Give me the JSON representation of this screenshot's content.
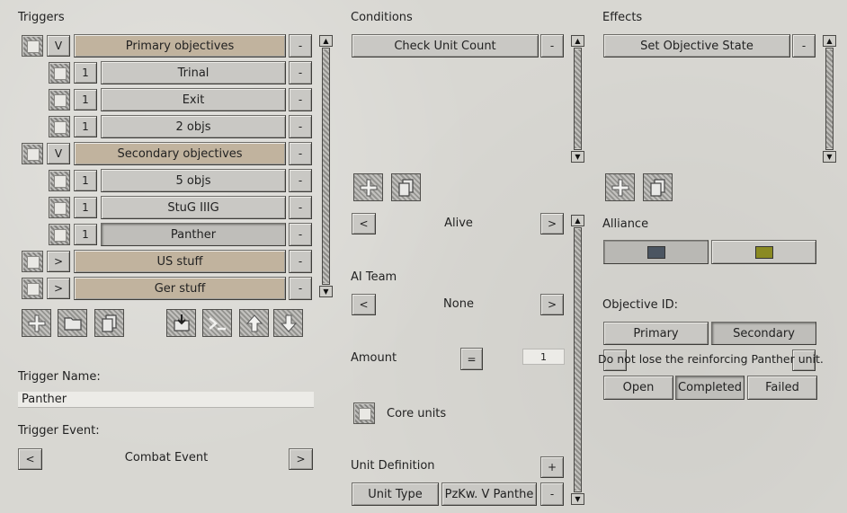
{
  "triggers": {
    "header": "Triggers",
    "rows": [
      {
        "toggle": "V",
        "name": "Primary objectives",
        "kind": "group"
      },
      {
        "toggle": "1",
        "name": "Trinal",
        "kind": "child"
      },
      {
        "toggle": "1",
        "name": "Exit",
        "kind": "child"
      },
      {
        "toggle": "1",
        "name": "2 objs",
        "kind": "child"
      },
      {
        "toggle": "V",
        "name": "Secondary objectives",
        "kind": "group"
      },
      {
        "toggle": "1",
        "name": "5 objs",
        "kind": "child"
      },
      {
        "toggle": "1",
        "name": "StuG IIIG",
        "kind": "child"
      },
      {
        "toggle": "1",
        "name": "Panther",
        "kind": "child-selected"
      },
      {
        "toggle": ">",
        "name": "US stuff",
        "kind": "group"
      },
      {
        "toggle": ">",
        "name": "Ger stuff",
        "kind": "group"
      }
    ],
    "remove_label": "-",
    "trigger_name_label": "Trigger Name:",
    "trigger_name_value": "Panther",
    "trigger_event_label": "Trigger Event:",
    "trigger_event_value": "Combat Event",
    "prev_label": "<",
    "next_label": ">"
  },
  "conditions": {
    "header": "Conditions",
    "item": "Check Unit Count",
    "remove_label": "-",
    "state_prev": "<",
    "state_value": "Alive",
    "state_next": ">",
    "ai_team_label": "AI Team",
    "ai_team_prev": "<",
    "ai_team_value": "None",
    "ai_team_next": ">",
    "amount_label": "Amount",
    "amount_operator": "=",
    "amount_value": "1",
    "core_units_label": "Core units",
    "unit_definition_label": "Unit Definition",
    "unit_add_label": "+",
    "unit_type_label": "Unit Type",
    "unit_type_value": "PzKw. V Panthe",
    "unit_remove_label": "-"
  },
  "effects": {
    "header": "Effects",
    "item": "Set Objective State",
    "remove_label": "-",
    "alliance_label": "Alliance",
    "alliance_colors": [
      "#4b5561",
      "#8a8a22"
    ],
    "objective_id_label": "Objective ID:",
    "primary_label": "Primary",
    "secondary_label": "Secondary",
    "objective_text": "Do not lose the reinforcing Panther unit.",
    "states": [
      "Open",
      "Completed",
      "Failed"
    ]
  },
  "icons": [
    "add-icon",
    "folder-icon",
    "copy-icon",
    "import-icon",
    "console-icon",
    "move-up-icon",
    "move-down-icon",
    "checkbox-icon"
  ]
}
